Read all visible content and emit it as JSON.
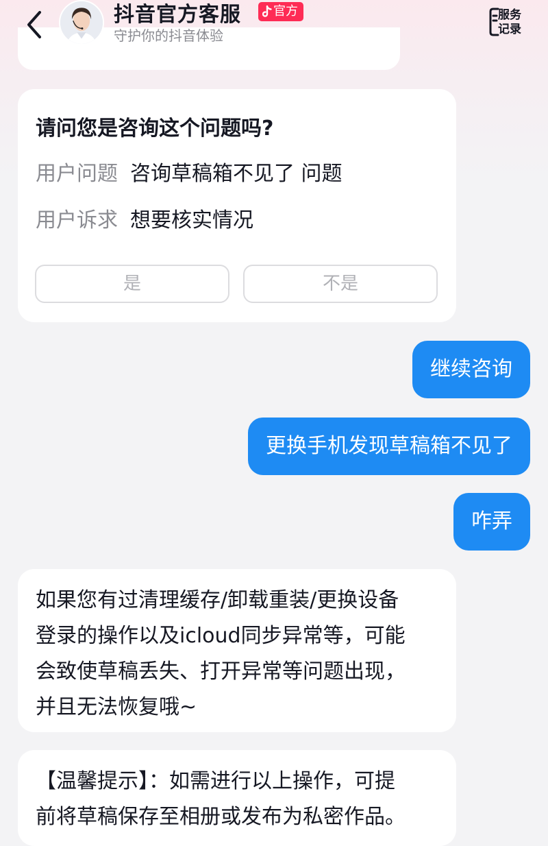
{
  "header": {
    "title": "抖音官方客服",
    "badge": "官方",
    "subtitle": "守护你的抖音体验",
    "service_records": "服务记录",
    "service_records_line1": "服务",
    "service_records_line2": "记录"
  },
  "confirm_card": {
    "question": "请问您是咨询这个问题吗?",
    "rows": [
      {
        "label": "用户问题",
        "value": "咨询草稿箱不见了 问题"
      },
      {
        "label": "用户诉求",
        "value": "想要核实情况"
      }
    ],
    "yes_label": "是",
    "no_label": "不是"
  },
  "user_messages": [
    {
      "text": "继续咨询"
    },
    {
      "text": "更换手机发现草稿箱不见了"
    },
    {
      "text": "咋弄"
    }
  ],
  "agent_messages": [
    {
      "lines": [
        "如果您有过清理缓存/卸载重装/更换设备",
        "登录的操作以及icloud同步异常等，可能",
        "会致使草稿丢失、打开异常等问题出现，",
        "并且无法恢复哦~"
      ]
    },
    {
      "lines": [
        "【温馨提示】：如需进行以上操作，可提",
        "前将草稿保存至相册或发布为私密作品。"
      ]
    }
  ],
  "colors": {
    "accent": "#1e8bf3",
    "badge": "#fe2c55"
  }
}
